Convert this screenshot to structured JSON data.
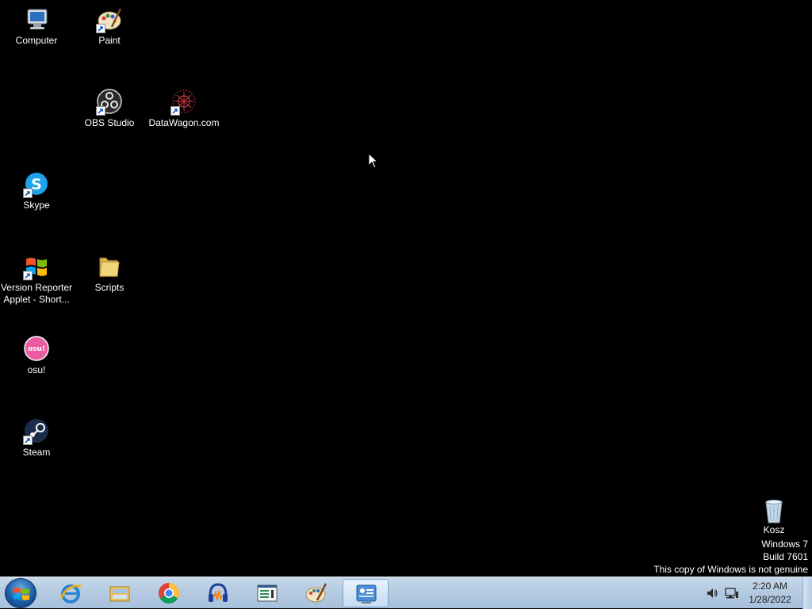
{
  "desktop": {
    "icons": [
      {
        "label": "Computer"
      },
      {
        "label": "Paint"
      },
      {
        "label": "OBS Studio"
      },
      {
        "label": "DataWagon.com"
      },
      {
        "label": "Skype"
      },
      {
        "label": "Version Reporter Applet - Short..."
      },
      {
        "label": "Scripts"
      },
      {
        "label": "osu!"
      },
      {
        "label": "Steam"
      }
    ],
    "recycle_bin": {
      "label": "Kosz"
    },
    "osu_logo_text": "osu!"
  },
  "watermark": {
    "line1": "Windows 7",
    "line2": "Build 7601",
    "line3": "This copy of Windows is not genuine"
  },
  "taskbar": {
    "start_icon": "windows-logo-icon",
    "pinned": [
      {
        "icon": "internet-explorer-icon"
      },
      {
        "icon": "file-explorer-icon"
      },
      {
        "icon": "chrome-icon"
      },
      {
        "icon": "audacity-icon"
      },
      {
        "icon": "app-window-icon"
      },
      {
        "icon": "paint-icon"
      },
      {
        "icon": "control-panel-icon",
        "active": true
      }
    ],
    "tray": {
      "volume_icon": "speaker-icon",
      "network_icon": "network-icon",
      "time": "2:20 AM",
      "date": "1/28/2022"
    }
  },
  "colors": {
    "desktop_bg": "#000000",
    "taskbar": "#b5cbe2",
    "text": "#ffffff"
  }
}
